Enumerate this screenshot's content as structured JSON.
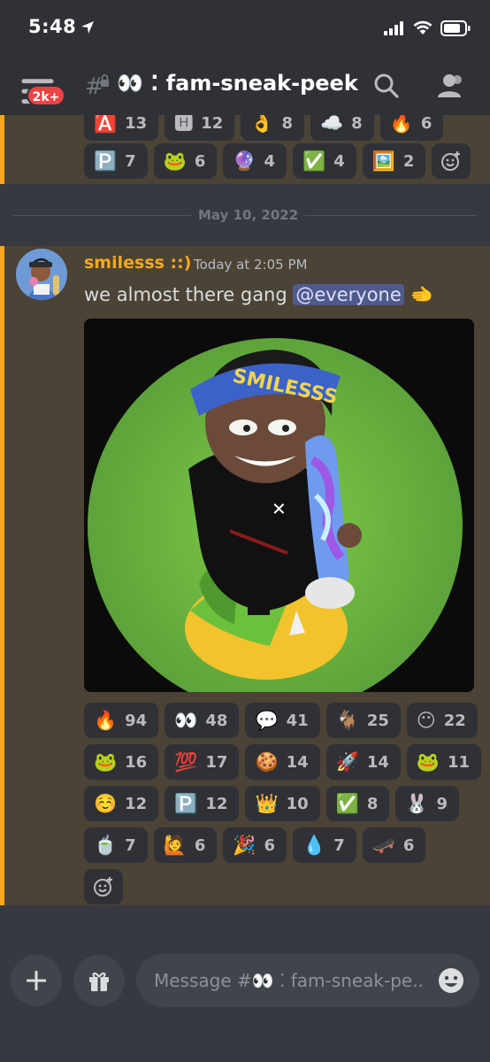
{
  "status_bar": {
    "time": "5:48"
  },
  "header": {
    "badge": "2k+",
    "channel_title": "👀 ⁚ fam-sneak-peek"
  },
  "reactions_prev": {
    "row1": [
      {
        "emoji": "🅰️",
        "count": "13"
      },
      {
        "emoji": "🅷",
        "count": "12"
      },
      {
        "emoji": "👌",
        "count": "8"
      },
      {
        "emoji": "☁️",
        "count": "8"
      },
      {
        "emoji": "🔥",
        "count": "6"
      }
    ],
    "row2": [
      {
        "emoji": "🅿️",
        "count": "7"
      },
      {
        "emoji": "🐸",
        "count": "6"
      },
      {
        "emoji": "🔮",
        "count": "4"
      },
      {
        "emoji": "✅",
        "count": "4"
      },
      {
        "emoji": "🖼️",
        "count": "2"
      }
    ]
  },
  "date_divider": "May 10, 2022",
  "message": {
    "author": "smilesss ::)",
    "timestamp": "Today at 2:05 PM",
    "text": "we almost there gang ",
    "mention": "@everyone",
    "trailing_emoji": "🫲"
  },
  "reactions": {
    "row1": [
      {
        "emoji": "🔥",
        "count": "94"
      },
      {
        "emoji": "👀",
        "count": "48"
      },
      {
        "emoji": "💬",
        "count": "41"
      },
      {
        "emoji": "🐐",
        "count": "25"
      },
      {
        "emoji": "😶",
        "count": "22"
      }
    ],
    "row2": [
      {
        "emoji": "🐸",
        "count": "16"
      },
      {
        "emoji": "💯",
        "count": "17"
      },
      {
        "emoji": "🍪",
        "count": "14"
      },
      {
        "emoji": "🚀",
        "count": "14"
      },
      {
        "emoji": "🐸",
        "count": "11"
      }
    ],
    "row3": [
      {
        "emoji": "☺️",
        "count": "12"
      },
      {
        "emoji": "🅿️",
        "count": "12"
      },
      {
        "emoji": "👑",
        "count": "10"
      },
      {
        "emoji": "✅",
        "count": "8"
      },
      {
        "emoji": "🐰",
        "count": "9"
      }
    ],
    "row4": [
      {
        "emoji": "🍵",
        "count": "7"
      },
      {
        "emoji": "🙋",
        "count": "6"
      },
      {
        "emoji": "🎉",
        "count": "6"
      },
      {
        "emoji": "💧",
        "count": "7"
      },
      {
        "emoji": "🛹",
        "count": "6"
      }
    ]
  },
  "composer": {
    "placeholder": "Message #👀 ⁚ fam-sneak-pe.."
  }
}
